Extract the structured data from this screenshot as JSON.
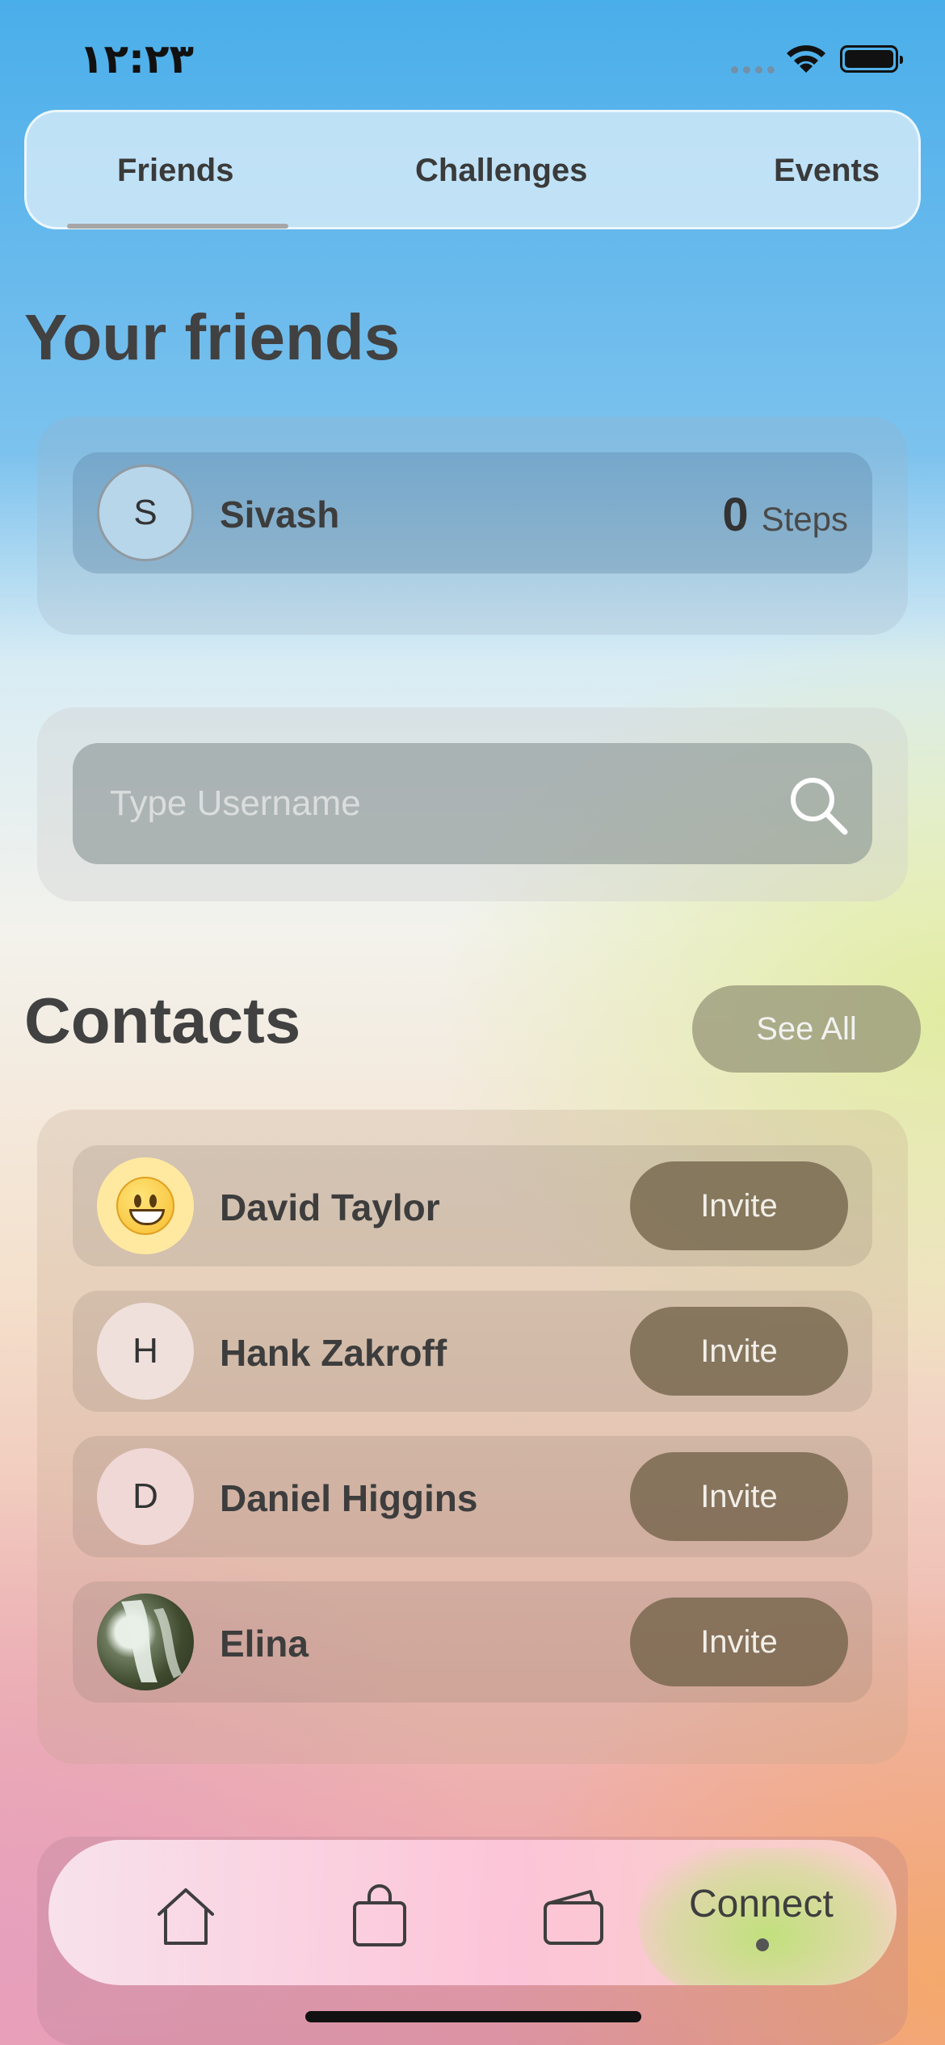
{
  "status_bar": {
    "time": "۱۲:۲۳"
  },
  "tabs": [
    {
      "label": "Friends",
      "active": true
    },
    {
      "label": "Challenges",
      "active": false
    },
    {
      "label": "Events",
      "active": false
    }
  ],
  "friends_section": {
    "title": "Your friends",
    "friends": [
      {
        "initial": "S",
        "name": "Sivash",
        "steps": "0",
        "steps_label": "Steps"
      }
    ]
  },
  "search": {
    "placeholder": "Type Username",
    "icon": "search-icon"
  },
  "contacts_section": {
    "title": "Contacts",
    "see_all_label": "See All",
    "contacts": [
      {
        "avatar": "emoji-grin",
        "name": "David Taylor",
        "action": "Invite"
      },
      {
        "initial": "H",
        "name": "Hank Zakroff",
        "action": "Invite"
      },
      {
        "initial": "D",
        "name": "Daniel Higgins",
        "action": "Invite"
      },
      {
        "avatar": "photo-waterfall",
        "name": "Elina",
        "action": "Invite"
      }
    ]
  },
  "bottom_nav": {
    "items": [
      {
        "icon": "home-icon"
      },
      {
        "icon": "shopping-bag-icon"
      },
      {
        "icon": "wallet-icon"
      },
      {
        "label": "Connect",
        "active": true
      }
    ],
    "active_color": "#c8e190"
  }
}
